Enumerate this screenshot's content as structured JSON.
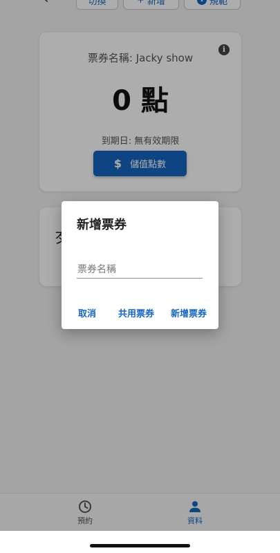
{
  "toolbar": {
    "switch_label": "切換",
    "add_label": "新增",
    "rules_label": "規範",
    "add_icon": "plus-icon",
    "rules_icon": "info-icon"
  },
  "ticket_card": {
    "name": "票券名稱: Jacky show",
    "points": "0 點",
    "expiry": "到期日: 無有效期限",
    "topup_label": "儲值點數",
    "topup_icon": "dollar-icon",
    "info_icon": "info-icon"
  },
  "second_card": {
    "title_fragment": "歹"
  },
  "dialog": {
    "title": "新增票券",
    "input_placeholder": "票券名稱",
    "input_value": "",
    "cancel_label": "取消",
    "shared_label": "共用票券",
    "add_label": "新增票券"
  },
  "bottom_nav": {
    "items": [
      {
        "label": "預約",
        "icon": "clock-icon",
        "active": false
      },
      {
        "label": "資料",
        "icon": "person-icon",
        "active": true
      }
    ]
  },
  "colors": {
    "accent": "#1565c0",
    "scrim": "rgba(0,0,0,0.32)"
  }
}
